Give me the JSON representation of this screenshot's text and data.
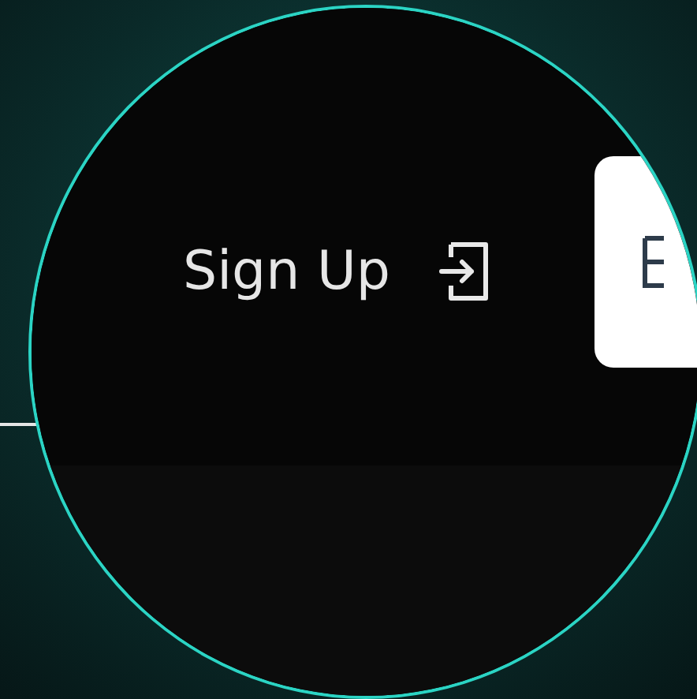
{
  "header": {
    "sign_up_link": {
      "label": "Sign Up"
    }
  }
}
